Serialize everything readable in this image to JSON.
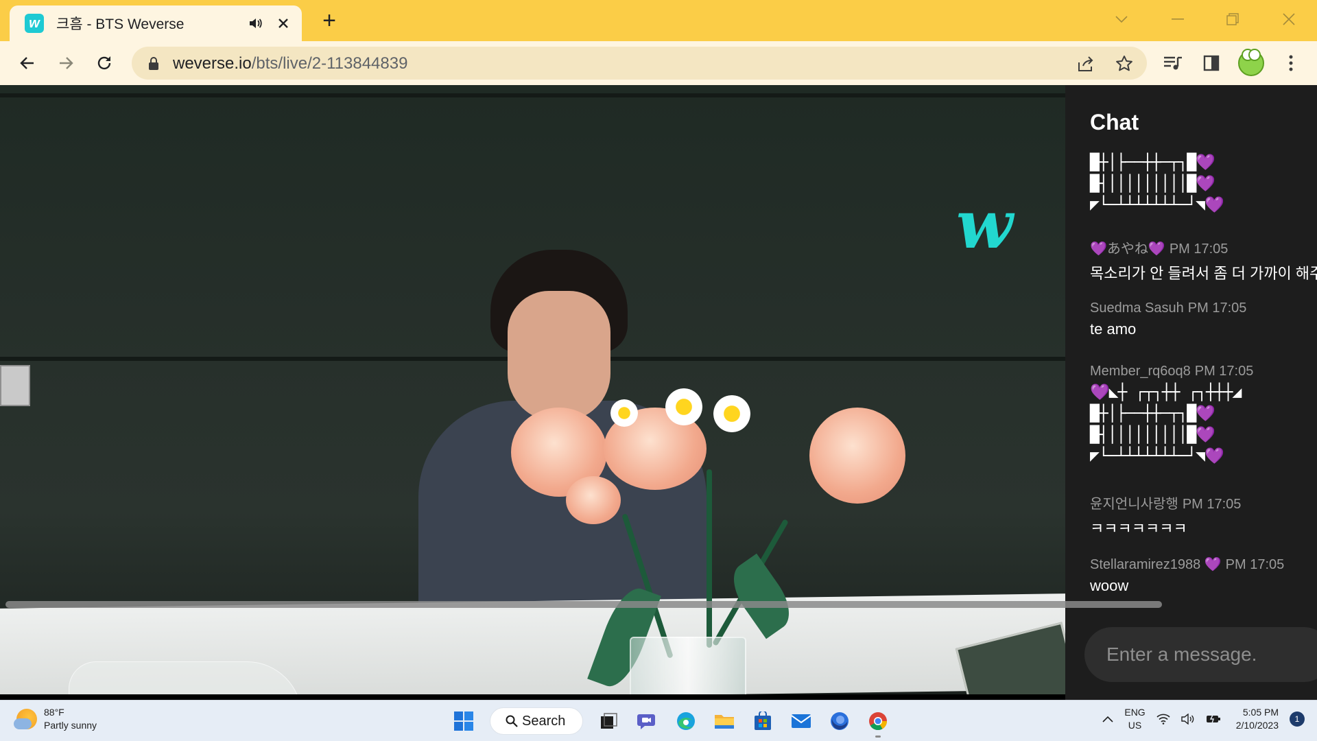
{
  "browser": {
    "tab": {
      "title": "크흠 - BTS Weverse",
      "favicon": "w"
    },
    "new_tab_label": "+",
    "url": {
      "host": "weverse.io",
      "path": "/bts/live/2-113844839"
    },
    "accent_color": "#fbcd47"
  },
  "video": {
    "logo_text": "w",
    "logo_color": "#22d7cf"
  },
  "chat": {
    "title": "Chat",
    "art_lines": [
      "█┼│├──┼┼─┬┐█💜",
      "█┤│││││││││█💜",
      "◤└─┴┴┴┴┴┴┴─┘◥💜"
    ],
    "messages": [
      {
        "user": "💜あやね💜",
        "time": "PM 17:05",
        "text": "목소리가 안 들려서 좀 더 가까이 해주"
      },
      {
        "user": "Suedma Sasuh",
        "time": "PM 17:05",
        "text": "te amo"
      },
      {
        "user": "Member_rq6oq8",
        "time": "PM 17:05",
        "text": "💜◣┼ ┌┬┐┼┼ ┌┐┼┼┼◢"
      },
      {
        "user": "윤지언니사랑행",
        "time": "PM 17:05",
        "text": "ㅋㅋㅋㅋㅋㅋㅋ"
      },
      {
        "user": "Stellaramirez1988 💜",
        "time": "PM 17:05",
        "text": "woow"
      }
    ],
    "input_placeholder": "Enter a message."
  },
  "taskbar": {
    "weather": {
      "temp": "88°F",
      "condition": "Partly sunny"
    },
    "search_label": "Search",
    "lang": {
      "line1": "ENG",
      "line2": "US"
    },
    "clock": {
      "time": "5:05 PM",
      "date": "2/10/2023"
    },
    "notification_count": "1"
  }
}
